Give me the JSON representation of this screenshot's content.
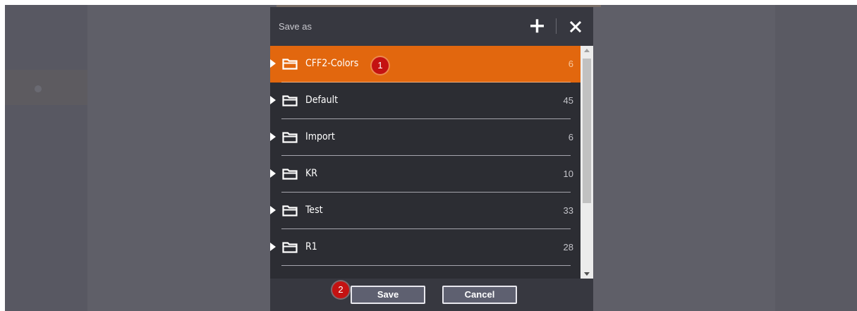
{
  "dialog": {
    "title": "Save as",
    "add_icon": "plus-icon",
    "close_icon": "close-icon"
  },
  "folders": [
    {
      "name": "CFF2-Colors",
      "count": "6",
      "selected": true
    },
    {
      "name": "Default",
      "count": "45"
    },
    {
      "name": "Import",
      "count": "6"
    },
    {
      "name": "KR",
      "count": "10"
    },
    {
      "name": "Test",
      "count": "33"
    },
    {
      "name": "R1",
      "count": "28"
    }
  ],
  "callouts": {
    "first": "1",
    "second": "2"
  },
  "footer": {
    "save_label": "Save",
    "cancel_label": "Cancel"
  },
  "colors": {
    "accent": "#e2670e",
    "dialog_bg": "#2c2d33",
    "header_bg": "#373840",
    "callout": "#c41212"
  }
}
